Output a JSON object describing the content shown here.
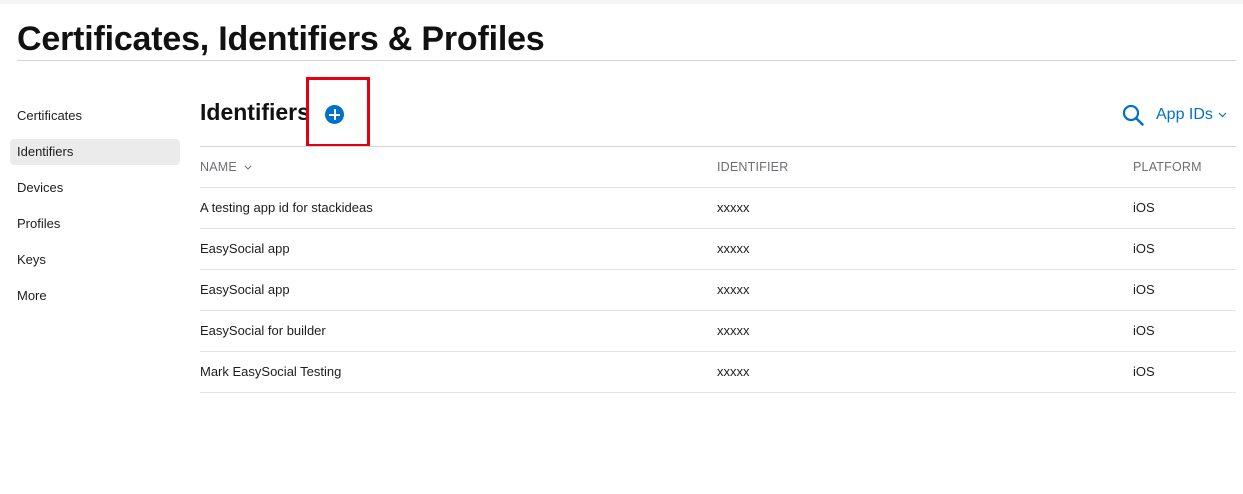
{
  "page": {
    "title": "Certificates, Identifiers & Profiles"
  },
  "sidebar": {
    "items": [
      {
        "label": "Certificates",
        "active": false
      },
      {
        "label": "Identifiers",
        "active": true
      },
      {
        "label": "Devices",
        "active": false
      },
      {
        "label": "Profiles",
        "active": false
      },
      {
        "label": "Keys",
        "active": false
      },
      {
        "label": "More",
        "active": false
      }
    ]
  },
  "main": {
    "section_title": "Identifiers",
    "add_icon": "plus-circle-icon",
    "search_icon": "search-icon",
    "filter": {
      "selected": "App IDs"
    },
    "columns": [
      "NAME",
      "IDENTIFIER",
      "PLATFORM"
    ],
    "rows": [
      {
        "name": "A testing app id for stackideas",
        "identifier": "xxxxx",
        "platform": "iOS"
      },
      {
        "name": "EasySocial app",
        "identifier": "xxxxx",
        "platform": "iOS"
      },
      {
        "name": "EasySocial app",
        "identifier": "xxxxx",
        "platform": "iOS"
      },
      {
        "name": "EasySocial for builder",
        "identifier": "xxxxx",
        "platform": "iOS"
      },
      {
        "name": "Mark EasySocial Testing",
        "identifier": "xxxxx",
        "platform": "iOS"
      }
    ]
  },
  "colors": {
    "accent": "#0070c9",
    "highlight": "#e3000f",
    "active_bg": "#ebebeb"
  }
}
